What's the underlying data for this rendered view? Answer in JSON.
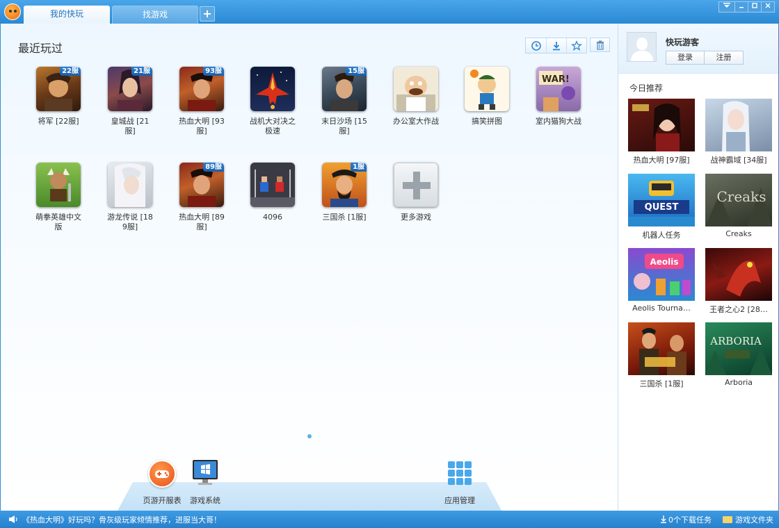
{
  "tabs": [
    {
      "label": "我的快玩"
    },
    {
      "label": "找游戏"
    }
  ],
  "tab_add": "+",
  "main": {
    "section_title": "最近玩过",
    "recent_games": [
      {
        "label": "将军 [22服]",
        "badge": "22服"
      },
      {
        "label": "皇城战 [21服]",
        "badge": "21服"
      },
      {
        "label": "热血大明 [93服]",
        "badge": "93服"
      },
      {
        "label": "战机大对决之极速",
        "badge": ""
      },
      {
        "label": "末日沙场 [15服]",
        "badge": "15服"
      },
      {
        "label": "办公室大作战",
        "badge": ""
      },
      {
        "label": "搞笑拼图",
        "badge": ""
      },
      {
        "label": "室内猫狗大战",
        "badge": ""
      },
      {
        "label": "萌拳英雄中文版",
        "badge": ""
      },
      {
        "label": "游龙传说 [189服]",
        "badge": ""
      },
      {
        "label": "热血大明 [89服]",
        "badge": "89服"
      },
      {
        "label": "4096",
        "badge": ""
      },
      {
        "label": "三国杀 [1服]",
        "badge": "1服"
      },
      {
        "label": "更多游戏",
        "badge": ""
      }
    ]
  },
  "dock": {
    "items": [
      {
        "label": "页游开服表"
      },
      {
        "label": "游戏系统"
      },
      {
        "label": "应用管理"
      }
    ]
  },
  "sidebar": {
    "user_name": "快玩游客",
    "login": "登录",
    "register": "注册",
    "rec_title": "今日推荐",
    "recommended": [
      {
        "label": "热血大明 [97服]"
      },
      {
        "label": "战神霸域 [34服]"
      },
      {
        "label": "机器人任务"
      },
      {
        "label": "Creaks"
      },
      {
        "label": "Aeolis Tourna…"
      },
      {
        "label": "王者之心2 [28…"
      },
      {
        "label": "三国杀 [1服]"
      },
      {
        "label": "Arboria"
      }
    ]
  },
  "status": {
    "message": "《热血大明》好玩吗？骨灰级玩家倾情推荐，进服当大哥！",
    "downloads": "0个下载任务",
    "folder": "游戏文件夹"
  },
  "colors": {
    "titlebar": "#2a89d4",
    "accent": "#2572b8",
    "statusbar": "#2780cc"
  }
}
